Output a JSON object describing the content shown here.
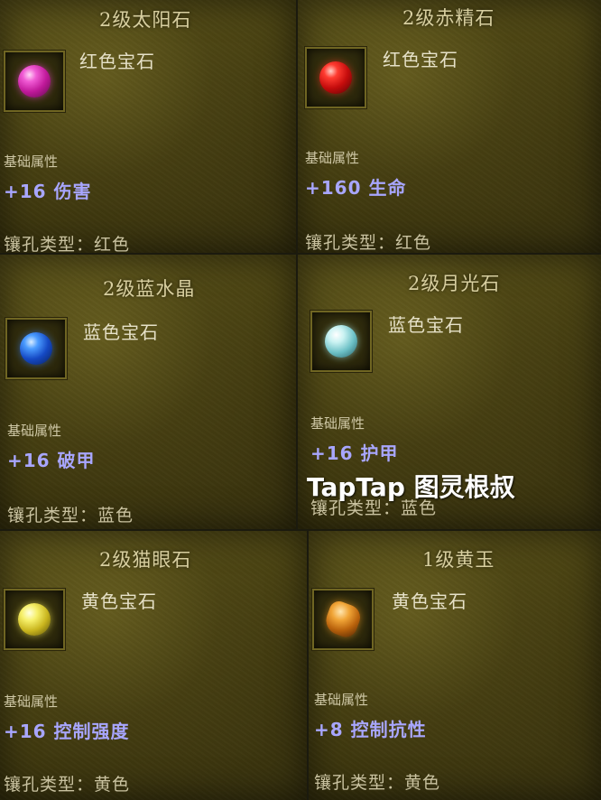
{
  "gems": [
    {
      "title": "2级太阳石",
      "type": "红色宝石",
      "attr_label": "基础属性",
      "attr_value": "+16 伤害",
      "socket": "镶孔类型：红色",
      "color": "#d12aa8",
      "icon": "magenta-gem-icon"
    },
    {
      "title": "2级赤精石",
      "type": "红色宝石",
      "attr_label": "基础属性",
      "attr_value": "+160 生命",
      "socket": "镶孔类型：红色",
      "color": "#cc1616",
      "icon": "red-gem-icon"
    },
    {
      "title": "2级蓝水晶",
      "type": "蓝色宝石",
      "attr_label": "基础属性",
      "attr_value": "+16 破甲",
      "socket": "镶孔类型：蓝色",
      "color": "#1f5fd6",
      "icon": "blue-gem-icon"
    },
    {
      "title": "2级月光石",
      "type": "蓝色宝石",
      "attr_label": "基础属性",
      "attr_value": "+16 护甲",
      "socket": "镶孔类型：蓝色",
      "color": "#8fd6da",
      "icon": "moonstone-gem-icon"
    },
    {
      "title": "2级猫眼石",
      "type": "黄色宝石",
      "attr_label": "基础属性",
      "attr_value": "+16 控制强度",
      "socket": "镶孔类型：黄色",
      "color": "#e6e04a",
      "icon": "yellow-gem-icon"
    },
    {
      "title": "1级黄玉",
      "type": "黄色宝石",
      "attr_label": "基础属性",
      "attr_value": "+8 控制抗性",
      "socket": "镶孔类型：黄色",
      "color": "#d8861c",
      "icon": "topaz-gem-icon"
    }
  ],
  "watermark": "TapTap 图灵根叔"
}
